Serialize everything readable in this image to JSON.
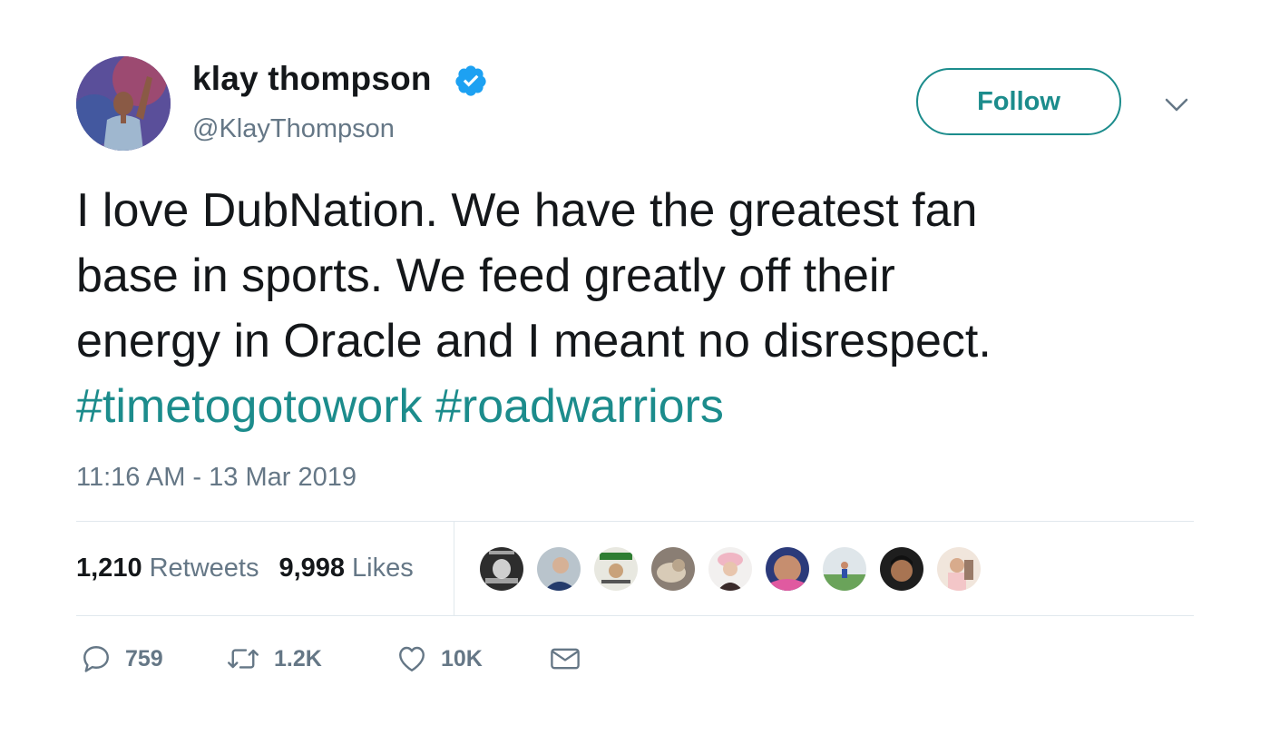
{
  "author": {
    "display_name": "klay thompson",
    "handle": "@KlayThompson",
    "verified": true,
    "verified_icon": "verified-badge-icon"
  },
  "header": {
    "follow_label": "Follow",
    "more_icon": "chevron-down-icon"
  },
  "tweet": {
    "lines": [
      "I love DubNation. We have the greatest fan",
      "base in sports. We feed greatly off their",
      "energy in Oracle and I meant no disrespect."
    ],
    "hashtags": [
      "#timetogotowork",
      "#roadwarriors"
    ],
    "timestamp": "11:16 AM - 13 Mar 2019"
  },
  "stats": {
    "retweets_count": "1,210",
    "retweets_label": "Retweets",
    "likes_count": "9,998",
    "likes_label": "Likes"
  },
  "actions": {
    "reply_count": "759",
    "retweet_count": "1.2K",
    "like_count": "10K",
    "icons": [
      "reply-icon",
      "retweet-icon",
      "heart-icon",
      "mail-icon"
    ]
  },
  "colors": {
    "accent": "#1c8c8c",
    "verified": "#1da1f2",
    "text": "#14171a",
    "muted": "#657786",
    "divider": "#e1e8ed"
  }
}
